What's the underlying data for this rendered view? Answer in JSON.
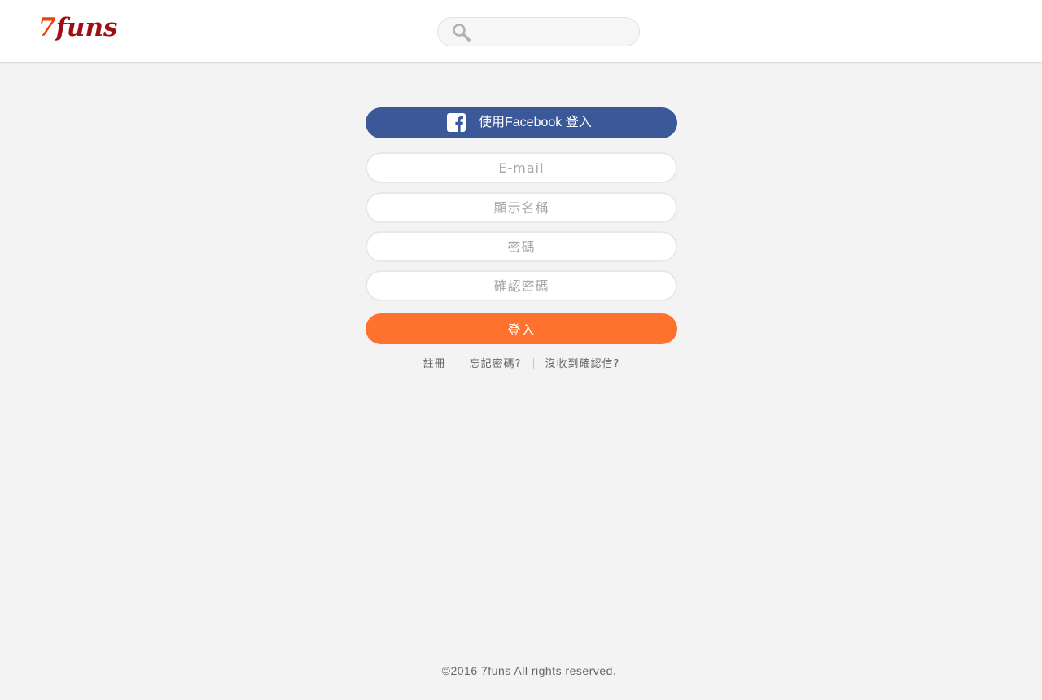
{
  "header": {
    "logo_seven": "7",
    "logo_rest": "funs",
    "search": {
      "placeholder": "",
      "value": ""
    }
  },
  "form": {
    "facebook_label": "使用Facebook 登入",
    "email_placeholder": "E-mail",
    "display_name_placeholder": "顯示名稱",
    "password_placeholder": "密碼",
    "confirm_password_placeholder": "確認密碼",
    "login_label": "登入"
  },
  "links": {
    "register": "註冊",
    "forgot_password": "忘記密碼?",
    "no_confirmation": "沒收到確認信?"
  },
  "footer": {
    "copyright": "©2016 7funs All rights reserved."
  },
  "colors": {
    "facebook": "#3b5998",
    "login": "#ff712f",
    "logo_seven": "#f2410f",
    "logo_rest": "#9e0e12",
    "background": "#f3f3f3"
  }
}
